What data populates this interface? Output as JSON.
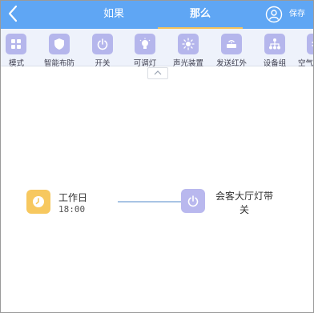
{
  "header": {
    "tabs": [
      {
        "label": "如果"
      },
      {
        "label": "那么"
      }
    ],
    "save_label": "保存",
    "colors": {
      "bar": "#5fa6f4",
      "active_underline": "#f6c35a"
    }
  },
  "toolbar": {
    "items": [
      {
        "label": "模式",
        "icon": "grid-icon"
      },
      {
        "label": "智能布防",
        "icon": "shield-icon"
      },
      {
        "label": "开关",
        "icon": "power-icon"
      },
      {
        "label": "可调灯",
        "icon": "bulb-icon"
      },
      {
        "label": "声光装置",
        "icon": "sun-icon"
      },
      {
        "label": "发送红外",
        "icon": "router-icon"
      },
      {
        "label": "设备组",
        "icon": "network-icon"
      },
      {
        "label": "空气",
        "icon": "air-icon"
      }
    ]
  },
  "flow": {
    "trigger": {
      "title": "工作日",
      "time": "18:00",
      "icon": "clock-icon",
      "color": "#f7c85f"
    },
    "action": {
      "label": "会客大厅灯带关",
      "icon": "power-icon",
      "color": "#b9b8ee"
    }
  }
}
